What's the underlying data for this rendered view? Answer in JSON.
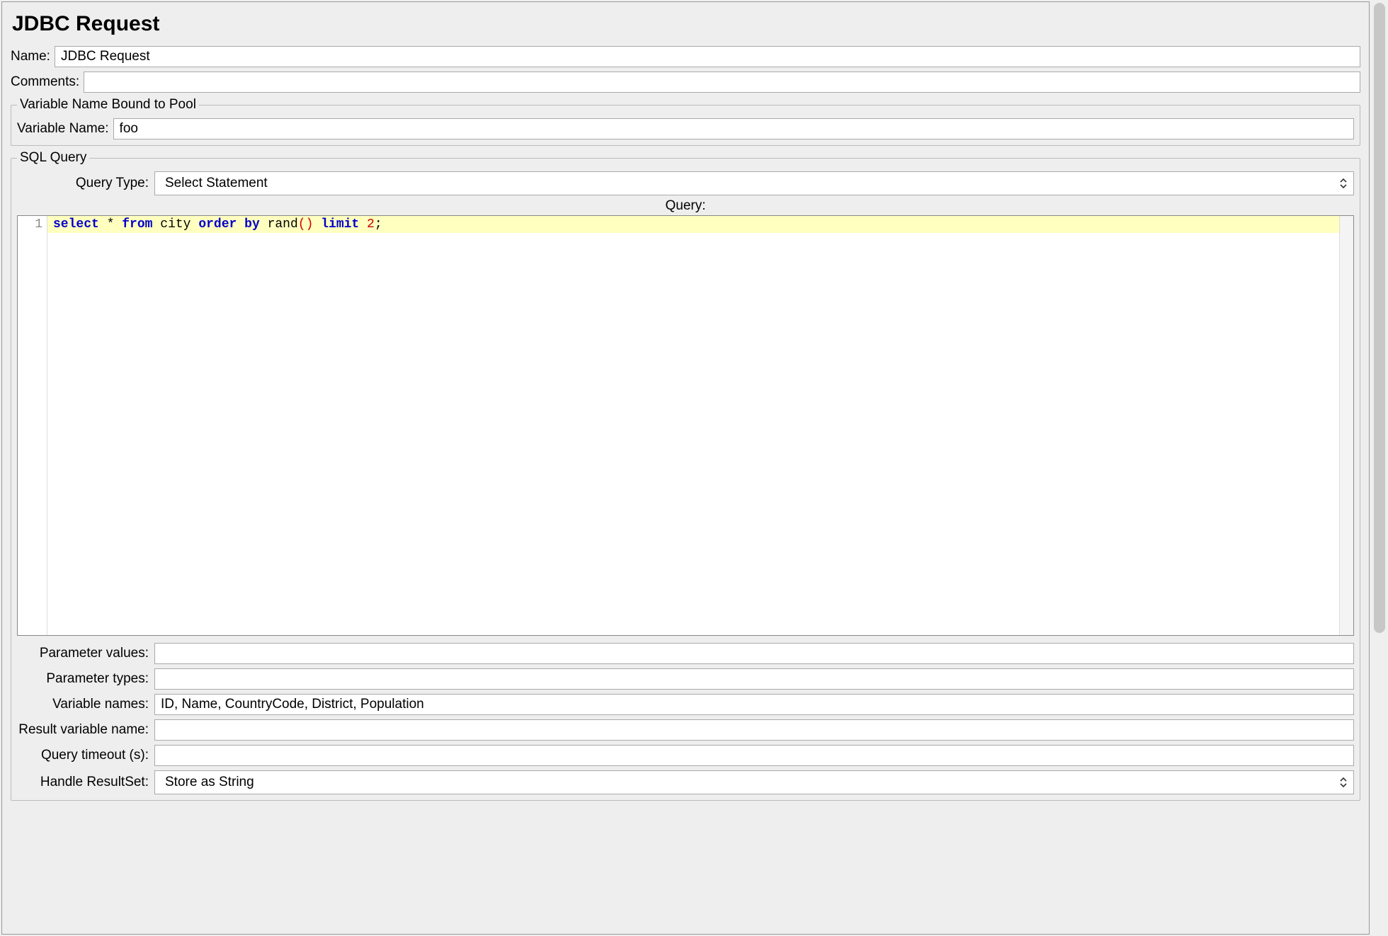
{
  "title": "JDBC Request",
  "name_label": "Name:",
  "name_value": "JDBC Request",
  "comments_label": "Comments:",
  "comments_value": "",
  "pool_legend": "Variable Name Bound to Pool",
  "variable_name_label": "Variable Name:",
  "variable_name_value": "foo",
  "sql_legend": "SQL Query",
  "query_type_label": "Query Type:",
  "query_type_value": "Select Statement",
  "query_label": "Query:",
  "query_line_number": "1",
  "query_tokens": {
    "select": "select",
    "star": "*",
    "from": "from",
    "city": "city",
    "order": "order",
    "by": "by",
    "rand": "rand",
    "lp": "(",
    "rp": ")",
    "limit": "limit",
    "two": "2",
    "semi": ";"
  },
  "param_values_label": "Parameter values:",
  "param_values_value": "",
  "param_types_label": "Parameter types:",
  "param_types_value": "",
  "variable_names_label": "Variable names:",
  "variable_names_value": "ID, Name, CountryCode, District, Population",
  "result_var_label": "Result variable name:",
  "result_var_value": "",
  "query_timeout_label": "Query timeout (s):",
  "query_timeout_value": "",
  "handle_rs_label": "Handle ResultSet:",
  "handle_rs_value": "Store as String"
}
